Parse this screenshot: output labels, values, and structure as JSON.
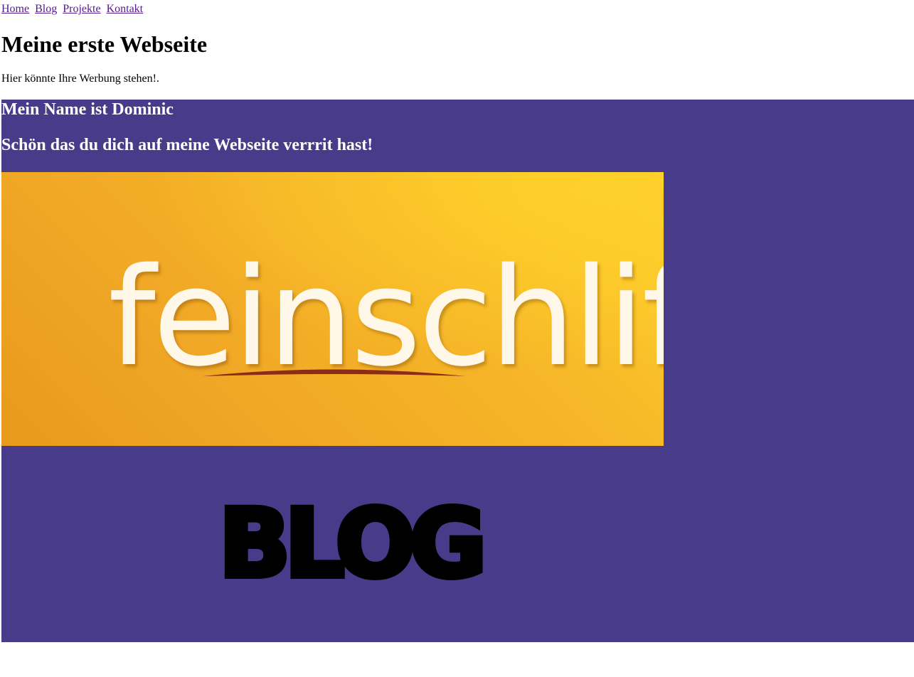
{
  "nav": {
    "links": [
      {
        "label": "Home"
      },
      {
        "label": "Blog"
      },
      {
        "label": "Projekte"
      },
      {
        "label": "Kontakt"
      }
    ]
  },
  "header": {
    "title": "Meine erste Webseite",
    "ad_text": "Hier könnte Ihre Werbung stehen!."
  },
  "intro": {
    "name_heading": "Mein Name ist Dominic",
    "welcome_heading": "Schön das du dich auf meine Webseite verrrit hast!"
  },
  "banner": {
    "logo_text": "feinschliff"
  },
  "blog_logo": {
    "text": "BLOG"
  },
  "colors": {
    "link": "#551a8b",
    "section_background": "#483c8a",
    "banner_orange": "#f1a926",
    "banner_yellow": "#ffd12b",
    "swoosh": "#8c2b17"
  }
}
